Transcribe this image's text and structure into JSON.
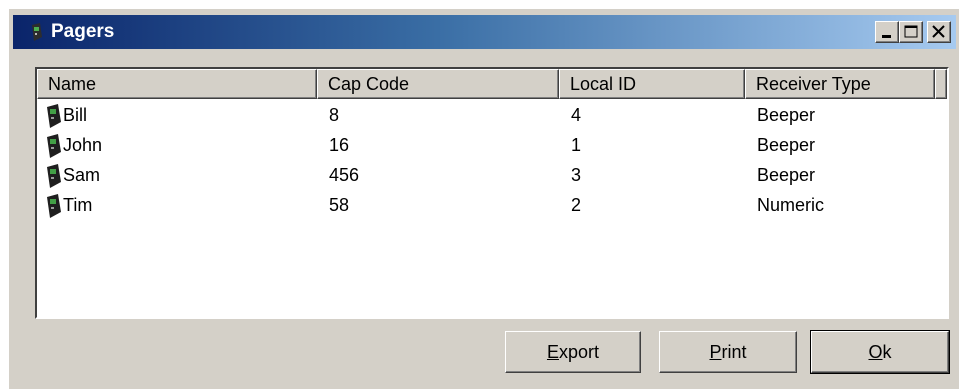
{
  "window": {
    "title": "Pagers",
    "icon": "pager-icon",
    "controls": [
      "minimize",
      "maximize",
      "close"
    ]
  },
  "list": {
    "columns": [
      "Name",
      "Cap Code",
      "Local ID",
      "Receiver Type"
    ],
    "rows": [
      {
        "name": "Bill",
        "cap_code": "8",
        "local_id": "4",
        "receiver_type": "Beeper"
      },
      {
        "name": "John",
        "cap_code": "16",
        "local_id": "1",
        "receiver_type": "Beeper"
      },
      {
        "name": "Sam",
        "cap_code": "456",
        "local_id": "3",
        "receiver_type": "Beeper"
      },
      {
        "name": "Tim",
        "cap_code": "58",
        "local_id": "2",
        "receiver_type": "Numeric"
      }
    ],
    "row_icon": "pager-icon"
  },
  "buttons": {
    "export": {
      "mnemonic": "E",
      "rest": "xport"
    },
    "print": {
      "mnemonic": "P",
      "rest": "rint"
    },
    "ok": {
      "mnemonic": "O",
      "rest": "k"
    }
  }
}
